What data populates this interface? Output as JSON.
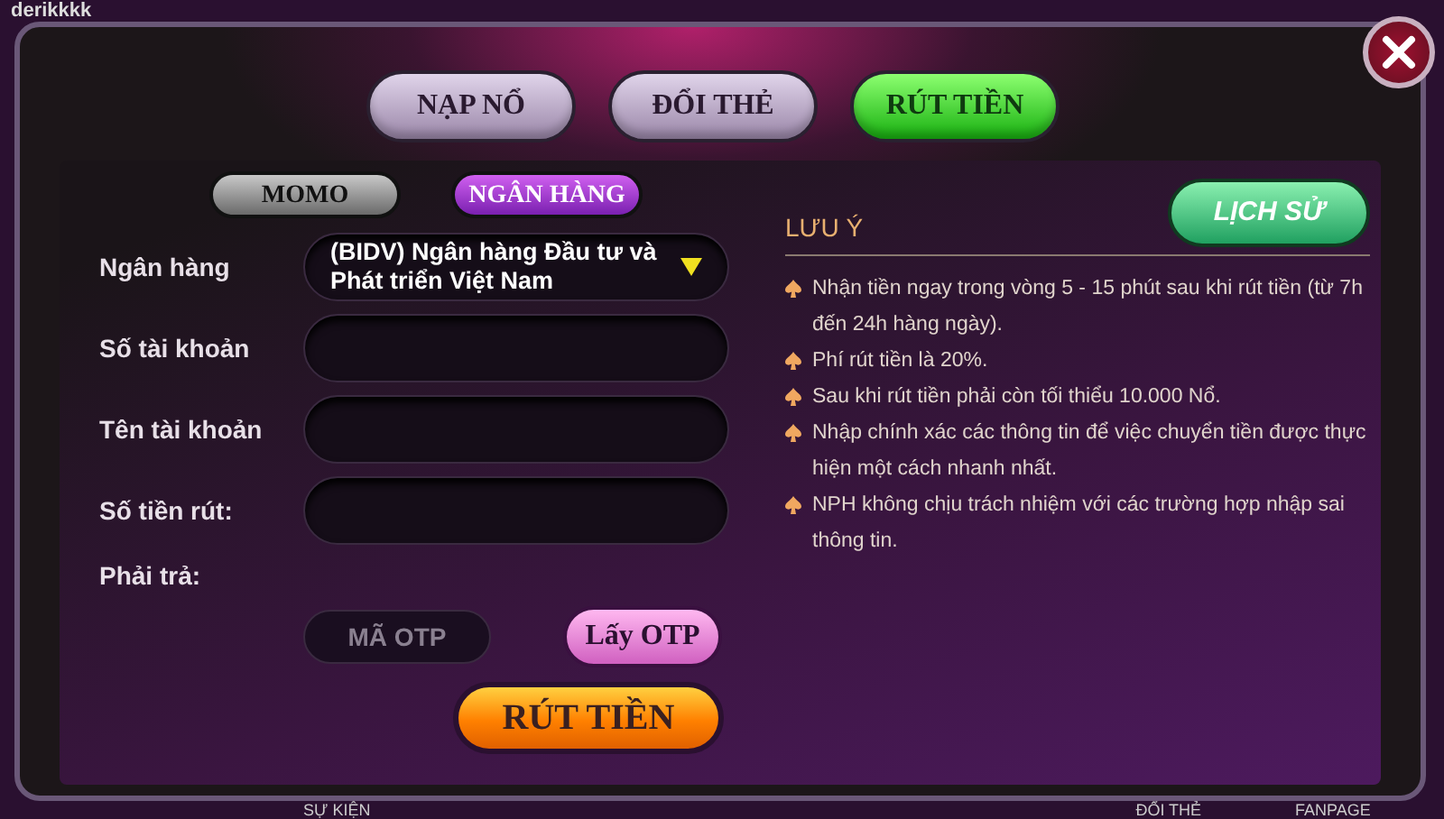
{
  "background": {
    "username": "derikkkk",
    "bottom_labels": [
      "SỰ KIỆN",
      "ĐỔI THẺ",
      "FANPAGE"
    ]
  },
  "tabs": [
    {
      "label": "NẠP NỔ",
      "selected": false
    },
    {
      "label": "ĐỔI THẺ",
      "selected": false
    },
    {
      "label": "RÚT TIỀN",
      "selected": true
    }
  ],
  "method_tabs": [
    {
      "label": "MOMO",
      "selected": false
    },
    {
      "label": "NGÂN HÀNG",
      "selected": true
    }
  ],
  "form": {
    "fields": [
      {
        "label": "Ngân hàng",
        "kind": "select",
        "value": "(BIDV) Ngân hàng Đầu tư và Phát triển Việt Nam"
      },
      {
        "label": "Số tài khoản",
        "kind": "input"
      },
      {
        "label": "Tên tài khoản",
        "kind": "input"
      },
      {
        "label": "Số tiền rút:",
        "kind": "input"
      },
      {
        "label": "Phải trả:",
        "kind": "text"
      }
    ],
    "otp": {
      "placeholder": "MÃ OTP",
      "button": "Lấy OTP"
    },
    "submit": "RÚT TIỀN"
  },
  "notes": {
    "history_button": "LỊCH SỬ",
    "title": "LƯU Ý",
    "items": [
      "Nhận tiền ngay trong vòng 5 - 15 phút sau khi rút tiền (từ 7h đến 24h hàng ngày).",
      "Phí rút tiền là 20%.",
      "Sau khi rút tiền phải còn tối thiểu 10.000 Nổ.",
      "Nhập chính xác các thông tin để việc chuyển tiền được thực hiện một cách nhanh nhất.",
      "NPH không chịu trách nhiệm với các trường hợp nhập sai thông tin."
    ]
  }
}
